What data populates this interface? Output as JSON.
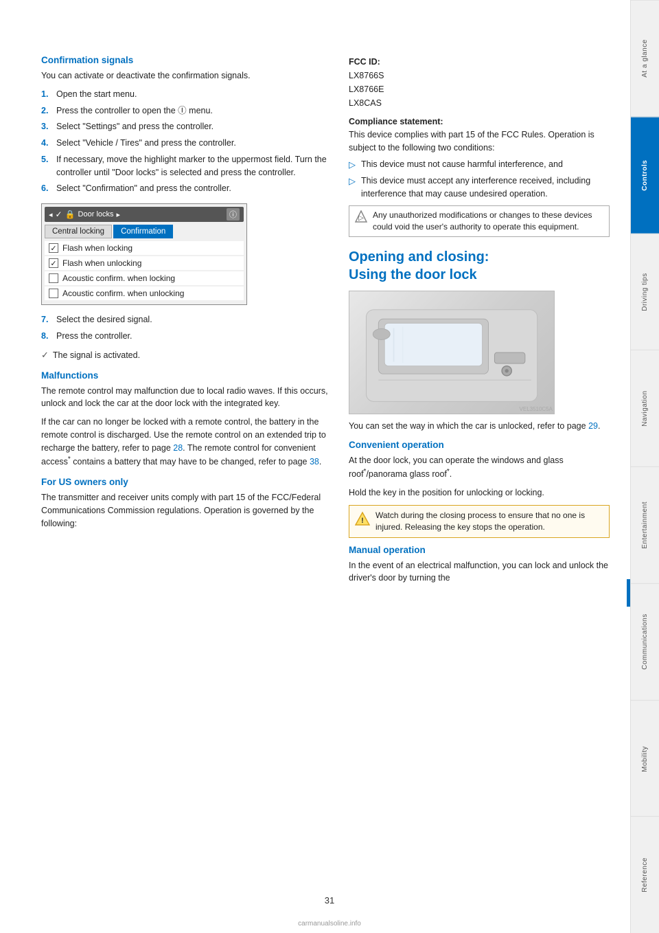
{
  "page": {
    "number": "31",
    "watermark": "carmanualsoline.info"
  },
  "sidebar": {
    "items": [
      {
        "id": "at-a-glance",
        "label": "At a glance",
        "active": false
      },
      {
        "id": "controls",
        "label": "Controls",
        "active": true
      },
      {
        "id": "driving-tips",
        "label": "Driving tips",
        "active": false
      },
      {
        "id": "navigation",
        "label": "Navigation",
        "active": false
      },
      {
        "id": "entertainment",
        "label": "Entertainment",
        "active": false
      },
      {
        "id": "communications",
        "label": "Communications",
        "active": false
      },
      {
        "id": "mobility",
        "label": "Mobility",
        "active": false
      },
      {
        "id": "reference",
        "label": "Reference",
        "active": false
      }
    ]
  },
  "left_col": {
    "confirmation_signals": {
      "title": "Confirmation signals",
      "intro": "You can activate or deactivate the confirmation signals.",
      "steps": [
        {
          "num": "1.",
          "text": "Open the start menu."
        },
        {
          "num": "2.",
          "text": "Press the controller to open the Ⓘ menu."
        },
        {
          "num": "3.",
          "text": "Select \"Settings\" and press the controller."
        },
        {
          "num": "4.",
          "text": "Select \"Vehicle / Tires\" and press the controller."
        },
        {
          "num": "5.",
          "text": "If necessary, move the highlight marker to the uppermost field. Turn the controller until \"Door locks\" is selected and press the controller."
        },
        {
          "num": "6.",
          "text": "Select \"Confirmation\" and press the controller."
        }
      ],
      "door_locks": {
        "nav_label": "Door locks",
        "tab1": "Central locking",
        "tab2": "Confirmation",
        "options": [
          {
            "checked": true,
            "label": "Flash when locking"
          },
          {
            "checked": true,
            "label": "Flash when unlocking"
          },
          {
            "checked": false,
            "label": "Acoustic confirm. when locking"
          },
          {
            "checked": false,
            "label": "Acoustic confirm. when unlocking"
          }
        ]
      },
      "steps2": [
        {
          "num": "7.",
          "text": "Select the desired signal."
        },
        {
          "num": "8.",
          "text": "Press the controller."
        }
      ],
      "checkmark_text": "The signal is activated."
    },
    "malfunctions": {
      "title": "Malfunctions",
      "para1": "The remote control may malfunction due to local radio waves. If this occurs, unlock and lock the car at the door lock with the integrated key.",
      "para2": "If the car can no longer be locked with a remote control, the battery in the remote control is discharged. Use the remote control on an extended trip to recharge the battery, refer to page 28. The remote control for convenient access* contains a battery that may have to be changed, refer to page 38.",
      "page_link_28": "28",
      "page_link_38": "38"
    },
    "for_us_owners": {
      "title": "For US owners only",
      "text": "The transmitter and receiver units comply with part 15 of the FCC/Federal Communications Commission regulations. Operation is governed by the following:"
    }
  },
  "right_col": {
    "fcc": {
      "id_label": "FCC ID:",
      "ids": [
        "LX8766S",
        "LX8766E",
        "LX8CAS"
      ]
    },
    "compliance": {
      "statement_label": "Compliance statement:",
      "text": "This device complies with part 15 of the FCC Rules. Operation is subject to the following two conditions:"
    },
    "bullets": [
      "This device must not cause harmful interference, and",
      "This device must accept any interference received, including interference that may cause undesired operation."
    ],
    "note_text": "Any unauthorized modifications or changes to these devices could void the user's authority to operate this equipment.",
    "opening_closing": {
      "title": "Opening and closing:\nUsing the door lock"
    },
    "door_image_alt": "Car door lock illustration",
    "image_watermark": "VEL3510C5A",
    "caption": "You can set the way in which the car is unlocked, refer to page 29.",
    "page_link_29": "29",
    "convenient_operation": {
      "title": "Convenient operation",
      "text1": "At the door lock, you can operate the windows and glass roof*/panorama glass roof*.",
      "text2": "Hold the key in the position for unlocking or locking."
    },
    "warning_text": "Watch during the closing process to ensure that no one is injured. Releasing the key stops the operation.",
    "manual_operation": {
      "title": "Manual operation",
      "text": "In the event of an electrical malfunction, you can lock and unlock the driver's door by turning the"
    }
  }
}
